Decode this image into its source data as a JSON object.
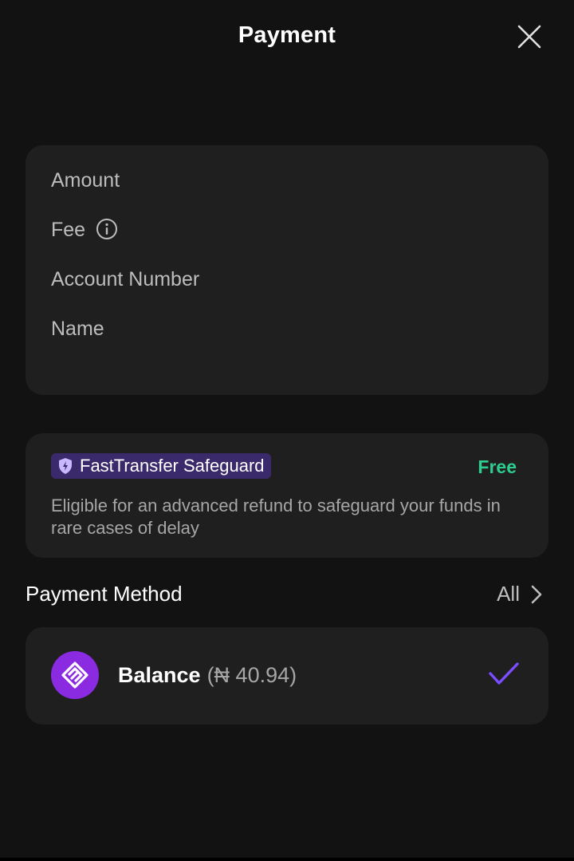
{
  "header": {
    "title": "Payment",
    "close_icon": "close-icon"
  },
  "details": {
    "amount_label": "Amount",
    "fee_label": "Fee",
    "account_number_label": "Account Number",
    "name_label": "Name"
  },
  "safeguard": {
    "badge_label": "FastTransfer Safeguard",
    "badge_icon": "shield-icon",
    "price_label": "Free",
    "description": "Eligible for an advanced refund to safeguard your funds in rare cases of delay"
  },
  "payment_method": {
    "label": "Payment Method",
    "all_label": "All",
    "selected": {
      "name": "Balance",
      "amount": "(₦ 40.94)",
      "logo_icon": "balance-logo-icon",
      "check_icon": "check-icon"
    }
  },
  "colors": {
    "background": "#121212",
    "card": "#1f1f1f",
    "accent_purple": "#8a2be2",
    "free_green": "#2ecc8f",
    "check_purple": "#7b4dff",
    "badge_bg": "#3a2a6b"
  }
}
